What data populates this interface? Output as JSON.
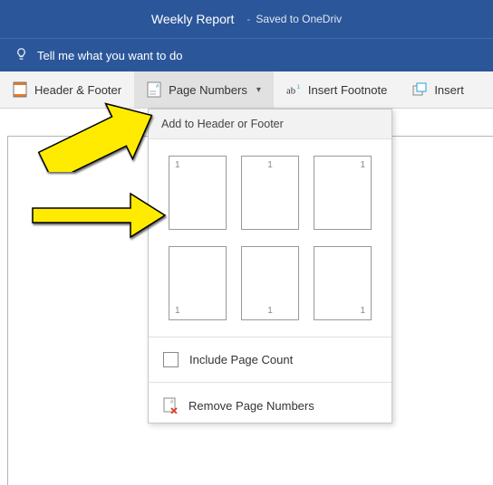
{
  "titlebar": {
    "title": "Weekly Report",
    "saved": "Saved to OneDriv"
  },
  "tellme": {
    "text": "Tell me what you want to do"
  },
  "ribbon": {
    "header_footer": "Header & Footer",
    "page_numbers": "Page Numbers",
    "insert_footnote": "Insert Footnote",
    "insert": "Insert"
  },
  "dropdown": {
    "header": "Add to Header or Footer",
    "thumb_number": "1",
    "include_page_count": "Include Page Count",
    "remove_page_numbers": "Remove Page Numbers"
  }
}
